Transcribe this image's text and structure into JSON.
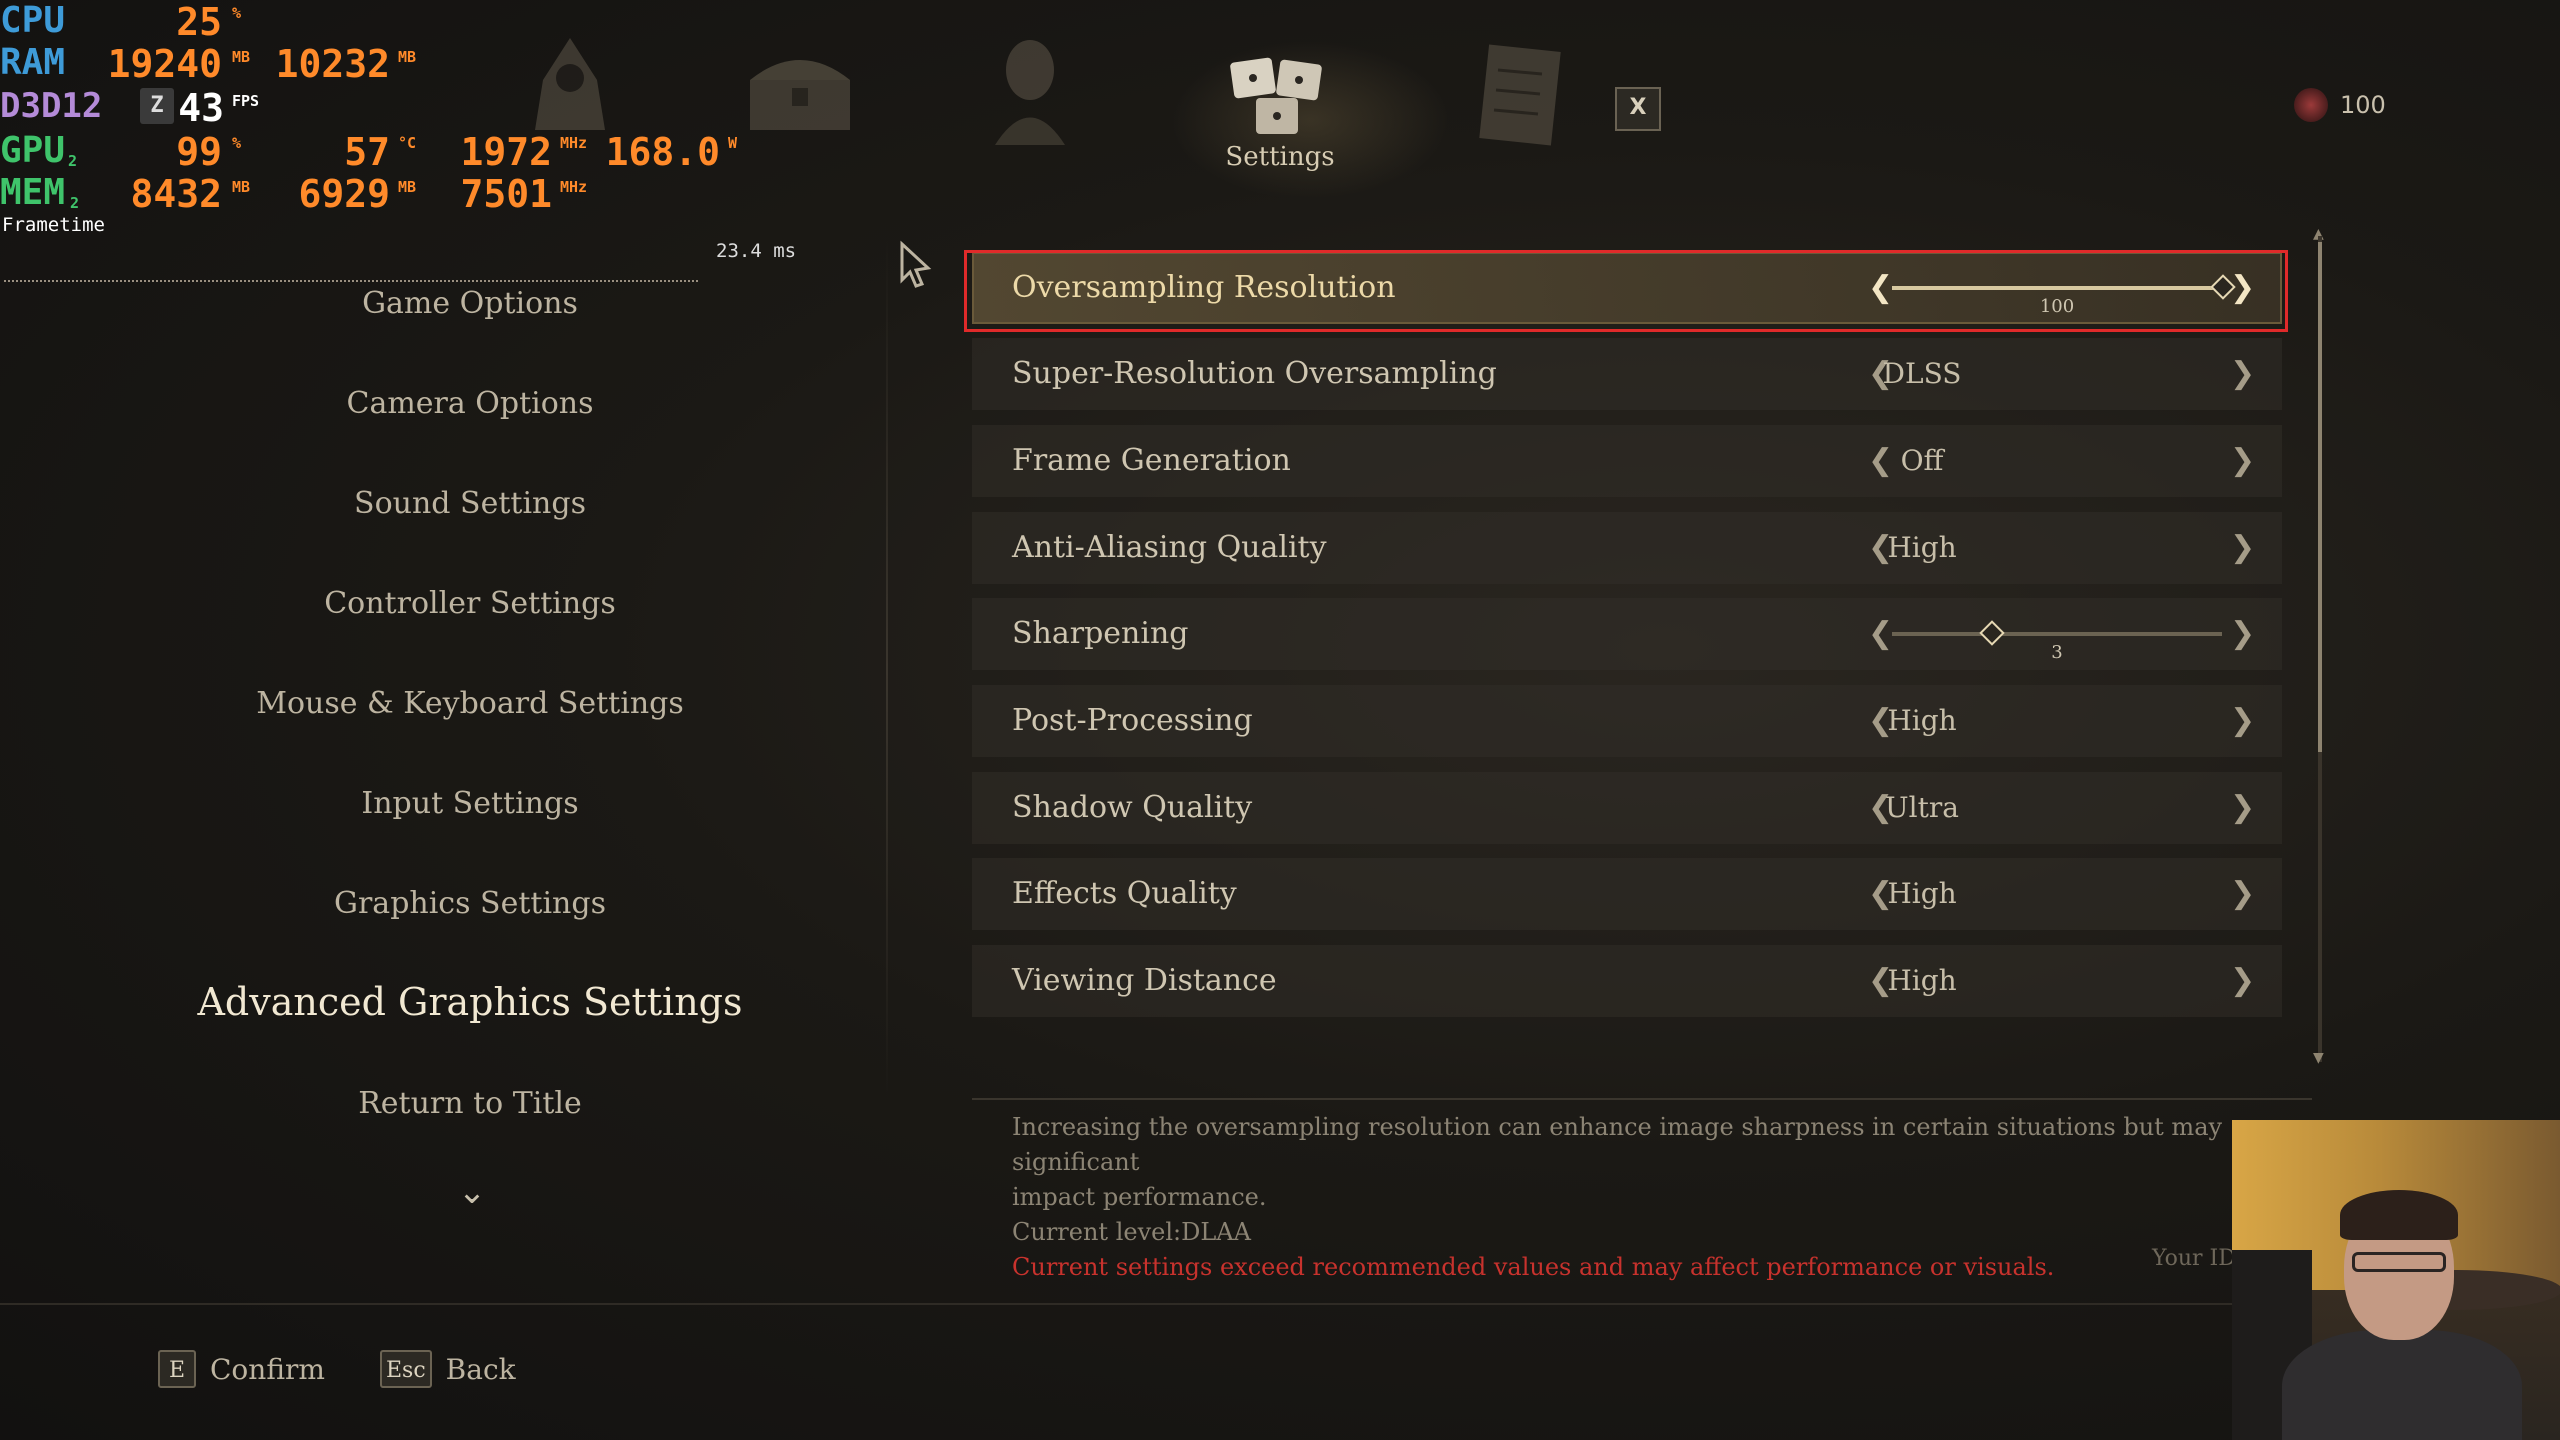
{
  "overlay": {
    "cpu": {
      "label": "CPU",
      "value": "25",
      "unit": "%"
    },
    "ram": {
      "label": "RAM",
      "value1": "19240",
      "unit1": "MB",
      "value2": "10232",
      "unit2": "MB"
    },
    "d3d": {
      "label": "D3D12",
      "z": "Z",
      "fps": "43",
      "fps_unit": "FPS"
    },
    "gpu": {
      "label": "GPU",
      "sub": "2",
      "usage": "99",
      "usage_unit": "%",
      "temp": "57",
      "temp_unit": "°C",
      "clock": "1972",
      "clock_unit": "MHz",
      "power": "168.0",
      "power_unit": "W"
    },
    "mem": {
      "label": "MEM",
      "sub": "2",
      "v1": "8432",
      "u1": "MB",
      "v2": "6929",
      "u2": "MB",
      "v3": "7501",
      "u3": "MHz"
    },
    "frametime_label": "Frametime",
    "frametime_ms": "23.4 ms"
  },
  "topbar": {
    "tabs": [
      {
        "icon": "hood-figure-icon",
        "label": ""
      },
      {
        "icon": "treasure-chest-icon",
        "label": ""
      },
      {
        "icon": "character-portrait-icon",
        "label": ""
      },
      {
        "icon": "dice-settings-icon",
        "label": "Settings"
      },
      {
        "icon": "document-scroll-icon",
        "label": ""
      }
    ],
    "close_label": "X",
    "currency_value": "100"
  },
  "menu": {
    "items": [
      {
        "label": "Game Options"
      },
      {
        "label": "Camera Options"
      },
      {
        "label": "Sound Settings"
      },
      {
        "label": "Controller Settings"
      },
      {
        "label": "Mouse & Keyboard Settings"
      },
      {
        "label": "Input Settings"
      },
      {
        "label": "Graphics Settings"
      },
      {
        "label": "Advanced Graphics Settings"
      },
      {
        "label": "Return to Title"
      }
    ],
    "active_index": 7
  },
  "settings": [
    {
      "label": "Oversampling Resolution",
      "type": "slider",
      "value": "100",
      "fraction": 1.0
    },
    {
      "label": "Super-Resolution Oversampling",
      "type": "select",
      "value": "DLSS"
    },
    {
      "label": "Frame Generation",
      "type": "select",
      "value": "Off"
    },
    {
      "label": "Anti-Aliasing Quality",
      "type": "select",
      "value": "High"
    },
    {
      "label": "Sharpening",
      "type": "slider",
      "value": "3",
      "fraction": 0.3
    },
    {
      "label": "Post-Processing",
      "type": "select",
      "value": "High"
    },
    {
      "label": "Shadow Quality",
      "type": "select",
      "value": "Ultra"
    },
    {
      "label": "Effects Quality",
      "type": "select",
      "value": "High"
    },
    {
      "label": "Viewing Distance",
      "type": "select",
      "value": "High"
    }
  ],
  "description": {
    "line1": "Increasing the oversampling resolution can enhance image sharpness in certain situations but may significant",
    "line2": "impact performance.",
    "line3": "Current level:DLAA",
    "warning": "Current settings exceed recommended values and may affect performance or visuals.",
    "your_id": "Your ID"
  },
  "hints": [
    {
      "key": "E",
      "label": "Confirm"
    },
    {
      "key": "Esc",
      "label": "Back"
    }
  ],
  "colors": {
    "highlight_frame": "#e02a2a",
    "overlay_value": "#ff8a2a",
    "warning_text": "#c8322d"
  }
}
